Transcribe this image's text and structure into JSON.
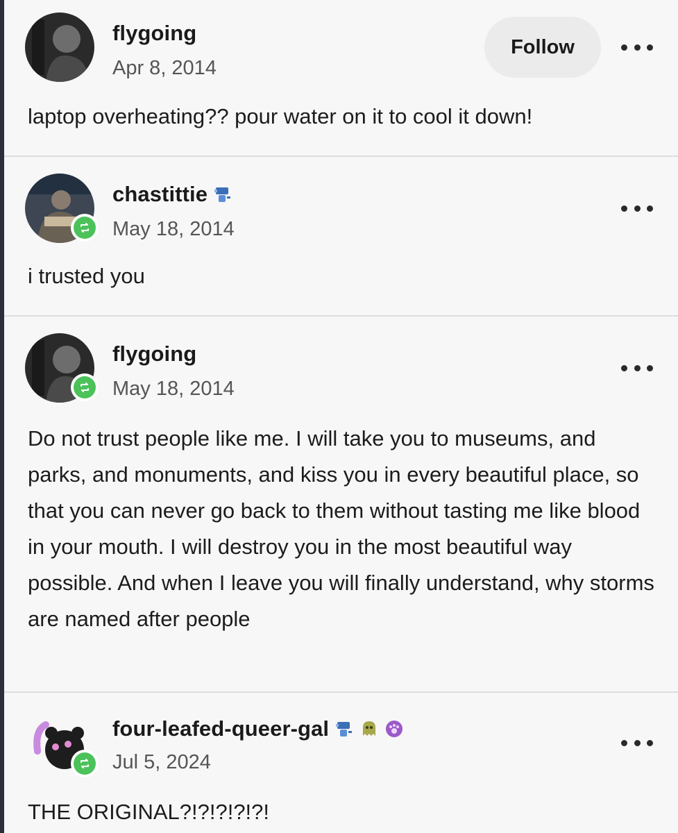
{
  "follow_label": "Follow",
  "posts": [
    {
      "username": "flygoing",
      "date": "Apr 8, 2014",
      "body": "laptop overheating?? pour water on it to cool it down!"
    },
    {
      "username": "chastittie",
      "date": "May 18, 2014",
      "body": "i trusted you"
    },
    {
      "username": "flygoing",
      "date": "May 18, 2014",
      "body": "Do not trust people like me. I will take you to museums, and parks, and monuments, and kiss you in every beautiful place, so that you can never go back to them without tasting me like blood in your mouth. I will destroy you in the most beautiful way possible. And when I leave you will finally understand, why storms are named after people"
    },
    {
      "username": "four-leafed-queer-gal",
      "date": "Jul 5, 2024",
      "body": "THE ORIGINAL?!?!?!?!?!"
    }
  ],
  "icons": {
    "more": "more-options-icon",
    "reblog": "reblog-icon",
    "badge_blue": "blue-badge-icon",
    "badge_ghost": "ghost-badge-icon",
    "badge_paw": "paw-badge-icon"
  },
  "colors": {
    "reblog_green": "#4cc25a",
    "background": "#f7f7f7",
    "divider": "#dedede"
  }
}
